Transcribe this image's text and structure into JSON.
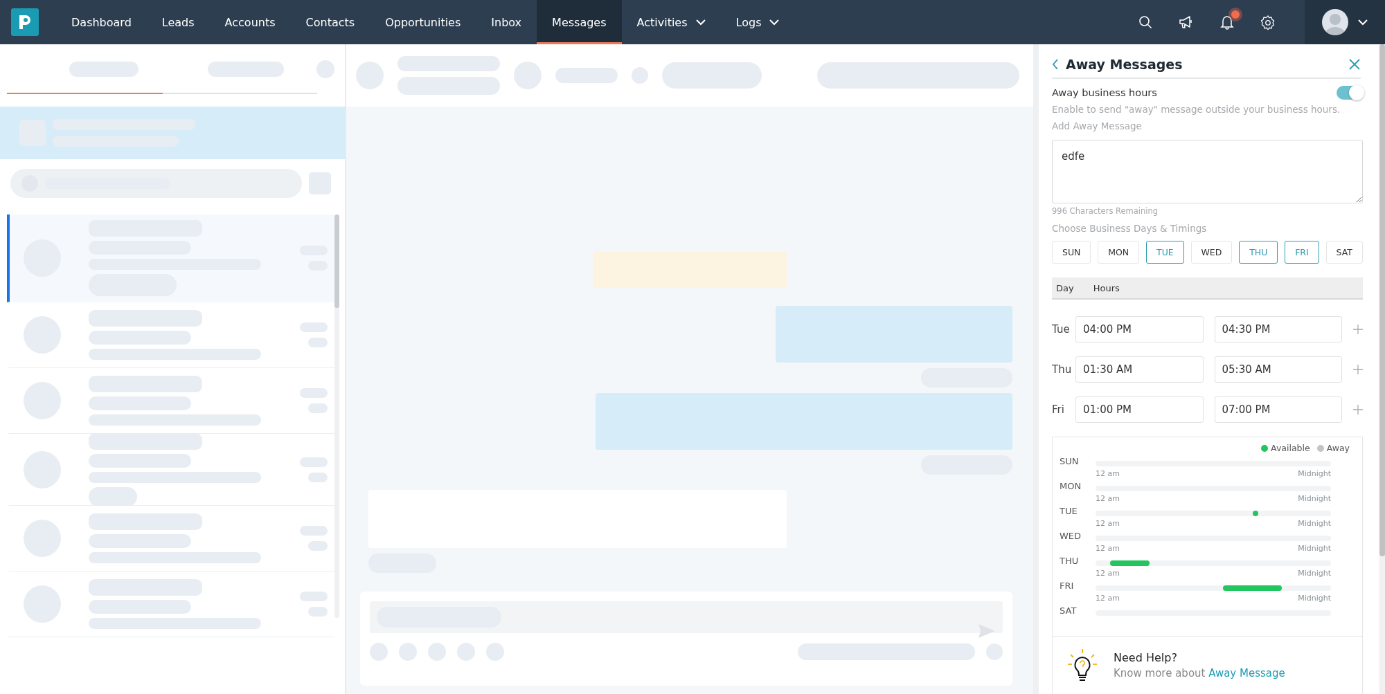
{
  "nav": {
    "items": [
      {
        "label": "Dashboard",
        "selected": false,
        "dropdown": false
      },
      {
        "label": "Leads",
        "selected": false,
        "dropdown": false
      },
      {
        "label": "Accounts",
        "selected": false,
        "dropdown": false
      },
      {
        "label": "Contacts",
        "selected": false,
        "dropdown": false
      },
      {
        "label": "Opportunities",
        "selected": false,
        "dropdown": false
      },
      {
        "label": "Inbox",
        "selected": false,
        "dropdown": false
      },
      {
        "label": "Messages",
        "selected": true,
        "dropdown": false
      },
      {
        "label": "Activities",
        "selected": false,
        "dropdown": true
      },
      {
        "label": "Logs",
        "selected": false,
        "dropdown": true
      }
    ],
    "unread_notifications": true
  },
  "panel": {
    "title": "Away Messages",
    "toggle": {
      "label": "Away business hours",
      "on": true
    },
    "hint": "Enable to send \"away\" message outside your business hours.",
    "message": {
      "label": "Add Away Message",
      "value": "edfe",
      "counter": "996 Characters Remaining"
    },
    "days_label": "Choose Business Days & Timings",
    "days": [
      {
        "label": "SUN",
        "selected": false
      },
      {
        "label": "MON",
        "selected": false
      },
      {
        "label": "TUE",
        "selected": true
      },
      {
        "label": "WED",
        "selected": false
      },
      {
        "label": "THU",
        "selected": true
      },
      {
        "label": "FRI",
        "selected": true
      },
      {
        "label": "SAT",
        "selected": false
      }
    ],
    "hours_columns": [
      "Day",
      "Hours"
    ],
    "hours": [
      {
        "day": "Tue",
        "from": "04:00 PM",
        "to": "04:30 PM"
      },
      {
        "day": "Thu",
        "from": "01:30 AM",
        "to": "05:30 AM"
      },
      {
        "day": "Fri",
        "from": "01:00 PM",
        "to": "07:00 PM"
      }
    ],
    "legend": [
      {
        "label": "Available",
        "color": "#22c55e"
      },
      {
        "label": "Away",
        "color": "#c4c4c4"
      }
    ],
    "timeline": [
      {
        "day": "SUN",
        "start": "12 am",
        "end": "Midnight"
      },
      {
        "day": "MON",
        "start": "12 am",
        "end": "Midnight"
      },
      {
        "day": "TUE",
        "start": "12 am",
        "end": "Midnight"
      },
      {
        "day": "WED",
        "start": "12 am",
        "end": "Midnight"
      },
      {
        "day": "THU",
        "start": "12 am",
        "end": "Midnight"
      },
      {
        "day": "FRI",
        "start": "12 am",
        "end": "Midnight"
      },
      {
        "day": "SAT"
      }
    ],
    "help": {
      "title": "Need Help?",
      "text": "Know more about",
      "link": "Away Message"
    }
  }
}
